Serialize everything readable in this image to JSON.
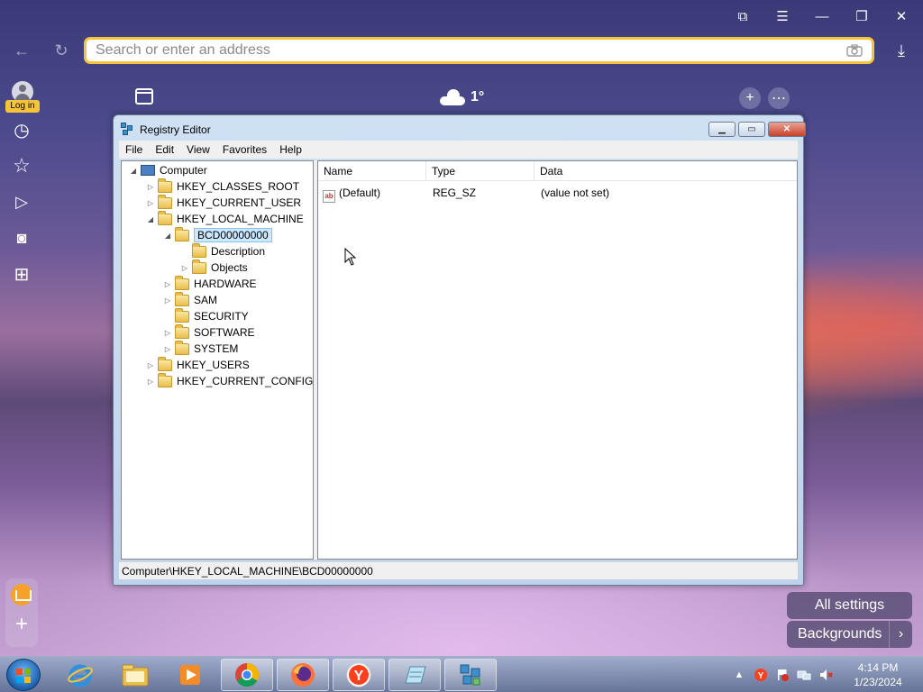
{
  "browser": {
    "address_placeholder": "Search or enter an address",
    "controls": {
      "bookmarks": "⧉",
      "menu": "☰",
      "minimize": "—",
      "restore": "❐",
      "close": "✕"
    },
    "nav": {
      "back": "←",
      "reload": "↻",
      "download": "⤓"
    }
  },
  "sidebar": {
    "login_label": "Log in",
    "icons": [
      "history-icon",
      "bookmarks-star-icon",
      "play-icon",
      "screenshot-icon",
      "apps-grid-icon"
    ],
    "glyphs": {
      "history": "◷",
      "star": "☆",
      "play": "▷",
      "screenshot": "◙",
      "apps": "⊞",
      "add": "+"
    }
  },
  "newtab": {
    "weather": "1°",
    "add": "+",
    "more": "⋯"
  },
  "regedit": {
    "title": "Registry Editor",
    "menu": [
      "File",
      "Edit",
      "View",
      "Favorites",
      "Help"
    ],
    "tree": [
      {
        "label": "Computer",
        "expander": "◢",
        "type": "computer"
      },
      {
        "label": "HKEY_CLASSES_ROOT",
        "expander": "▷",
        "type": "folder"
      },
      {
        "label": "HKEY_CURRENT_USER",
        "expander": "▷",
        "type": "folder"
      },
      {
        "label": "HKEY_LOCAL_MACHINE",
        "expander": "◢",
        "type": "folder"
      },
      {
        "label": "BCD00000000",
        "expander": "◢",
        "type": "folder",
        "selected": true
      },
      {
        "label": "Description",
        "expander": "",
        "type": "folder"
      },
      {
        "label": "Objects",
        "expander": "▷",
        "type": "folder"
      },
      {
        "label": "HARDWARE",
        "expander": "▷",
        "type": "folder"
      },
      {
        "label": "SAM",
        "expander": "▷",
        "type": "folder"
      },
      {
        "label": "SECURITY",
        "expander": "",
        "type": "folder"
      },
      {
        "label": "SOFTWARE",
        "expander": "▷",
        "type": "folder"
      },
      {
        "label": "SYSTEM",
        "expander": "▷",
        "type": "folder"
      },
      {
        "label": "HKEY_USERS",
        "expander": "▷",
        "type": "folder"
      },
      {
        "label": "HKEY_CURRENT_CONFIG",
        "expander": "▷",
        "type": "folder"
      }
    ],
    "columns": [
      "Name",
      "Type",
      "Data"
    ],
    "values": [
      {
        "icon": "ab",
        "name": "(Default)",
        "type": "REG_SZ",
        "data": "(value not set)"
      }
    ],
    "status": "Computer\\HKEY_LOCAL_MACHINE\\BCD00000000"
  },
  "newtab_buttons": {
    "all_settings": "All settings",
    "backgrounds": "Backgrounds",
    "chevron": "›"
  },
  "taskbar": {
    "apps": [
      "internet-explorer",
      "file-explorer",
      "media-player",
      "chrome",
      "firefox",
      "yandex-browser",
      "notepad",
      "registry-editor"
    ],
    "glyphs": {
      "yandex": "Y"
    },
    "clock": {
      "time": "4:14 PM",
      "date": "1/23/2024"
    }
  },
  "colors": {
    "address_border": "#f5c43a",
    "login_badge": "#f5c43a",
    "selection": "#cce8ff"
  }
}
